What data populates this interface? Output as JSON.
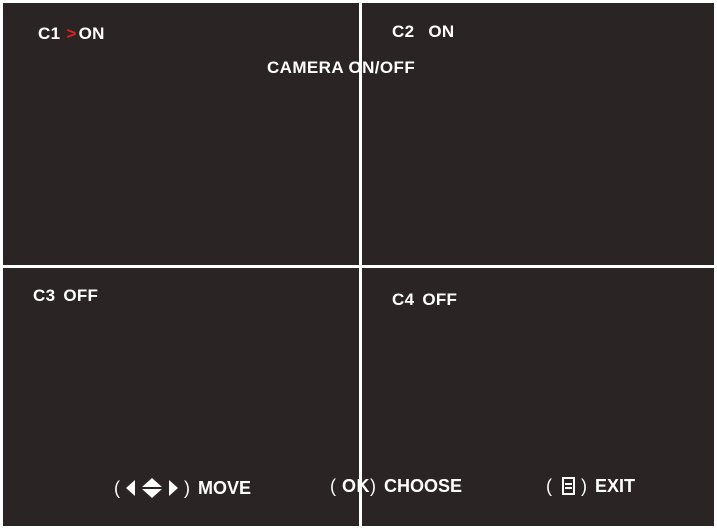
{
  "title": "CAMERA ON/OFF",
  "cameras": [
    {
      "name": "C1",
      "state": "ON",
      "selected": true
    },
    {
      "name": "C2",
      "state": "ON",
      "selected": false
    },
    {
      "name": "C3",
      "state": "OFF",
      "selected": false
    },
    {
      "name": "C4",
      "state": "OFF",
      "selected": false
    }
  ],
  "cursor": {
    "glyph": ">",
    "color": "#e02020"
  },
  "hints": {
    "open_paren": "(",
    "close_paren": ")",
    "move_icon": "arrows-icon",
    "move_label": "MOVE",
    "ok_key": "OK",
    "choose_label": "CHOOSE",
    "exit_icon": "menu-icon",
    "exit_label": "EXIT"
  },
  "colors": {
    "background": "#2a2524",
    "divider": "#ffffff",
    "text": "#ffffff"
  }
}
